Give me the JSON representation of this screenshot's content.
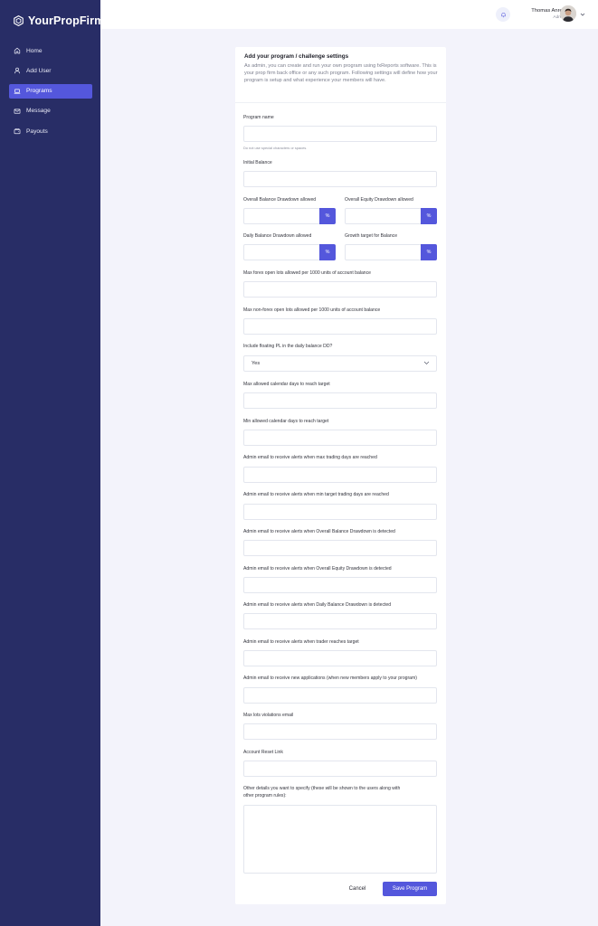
{
  "brand": {
    "name": "YourPropFirm"
  },
  "sidebar": {
    "items": [
      {
        "label": "Home",
        "icon": "home-icon"
      },
      {
        "label": "Add User",
        "icon": "user-icon"
      },
      {
        "label": "Programs",
        "icon": "laptop-icon",
        "active": true
      },
      {
        "label": "Message",
        "icon": "envelope-icon"
      },
      {
        "label": "Payouts",
        "icon": "wallet-icon"
      }
    ]
  },
  "topbar": {
    "user_name": "Thomas Anree",
    "user_role": "Admin"
  },
  "form": {
    "title": "Add your program / challenge settings",
    "description": "As admin, you can create and run your own program using fxReports software. This is your prop firm back office or any such program. Following settings will define how your program is setup and what experience your members will have.",
    "program_name_label": "Program name",
    "program_name_hint": "Do not use special characters or spaces.",
    "initial_balance_label": "Initial Balance",
    "overall_balance_dd_label": "Overall Balance Drawdown allowed",
    "overall_equity_dd_label": "Overall Equity Drawdown allowed",
    "daily_balance_dd_label": "Daily Balance Drawdown allowed",
    "growth_target_label": "Growth target for Balance",
    "percent_symbol": "%",
    "max_forex_lots_label": "Max forex open lots allowed per 1000 units of account balance",
    "max_nonforex_lots_label": "Max non-forex open lots allowed per 1000 units of account balance",
    "floating_pl_label": "Include floating PL in the daily balance DD?",
    "floating_pl_value": "Yes",
    "max_days_label": "Max allowed calendar days to reach target",
    "min_days_label": "Min allowed calendar days to reach target",
    "email_max_days_label": "Admin email to receive alerts when max trading days are reached",
    "email_min_days_label": "Admin email to receive alerts when min target trading days are reached",
    "email_overall_balance_label": "Admin email to receive alerts when Overall Balance Drawdown is detected",
    "email_overall_equity_label": "Admin email to receive alerts when Overall Equity Drawdown is detected",
    "email_daily_balance_label": "Admin email to receive alerts when Daily Balance Drawdown is detected",
    "email_target_label": "Admin email to receive alerts when trader reaches target",
    "email_applications_label": "Admin email to receive new applications (when new members apply to your program)",
    "max_lots_email_label": "Max lots violations email",
    "reset_link_label": "Account Reset Link",
    "other_details_label_line1": "Other details you want to specify (these will be shown to the users along with",
    "other_details_label_line2": "other program rules):",
    "cancel_label": "Cancel",
    "save_label": "Save Program"
  },
  "colors": {
    "sidebar_bg": "#282d66",
    "accent": "#5457dc",
    "page_bg": "#f3f3fb"
  }
}
